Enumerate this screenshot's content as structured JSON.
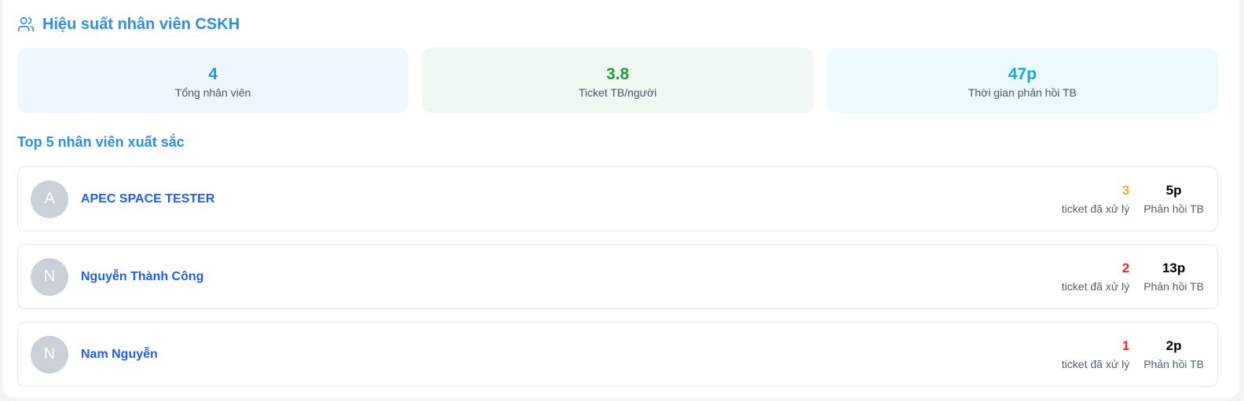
{
  "header": {
    "title": "Hiệu suất nhân viên CSKH",
    "icon": "users-icon"
  },
  "stats": [
    {
      "value": "4",
      "label": "Tổng nhân viên",
      "color": "#2b8fe0"
    },
    {
      "value": "3.8",
      "label": "Ticket TB/người",
      "color": "#1f9d3f"
    },
    {
      "value": "47p",
      "label": "Thời gian phản hồi TB",
      "color": "#16a9c9"
    }
  ],
  "section_title": "Top 5 nhân viên xuất sắc",
  "employees": [
    {
      "initial": "A",
      "name": "APEC SPACE TESTER",
      "tickets": "3",
      "tickets_color": "#f5a623",
      "tickets_label": "ticket đã xử lý",
      "response": "5p",
      "response_label": "Phản hồi TB"
    },
    {
      "initial": "N",
      "name": "Nguyễn Thành Công",
      "tickets": "2",
      "tickets_color": "#f02a2a",
      "tickets_label": "ticket đã xử lý",
      "response": "13p",
      "response_label": "Phản hồi TB"
    },
    {
      "initial": "N",
      "name": "Nam Nguyễn",
      "tickets": "1",
      "tickets_color": "#f02a2a",
      "tickets_label": "ticket đã xử lý",
      "response": "2p",
      "response_label": "Phản hồi TB"
    }
  ]
}
